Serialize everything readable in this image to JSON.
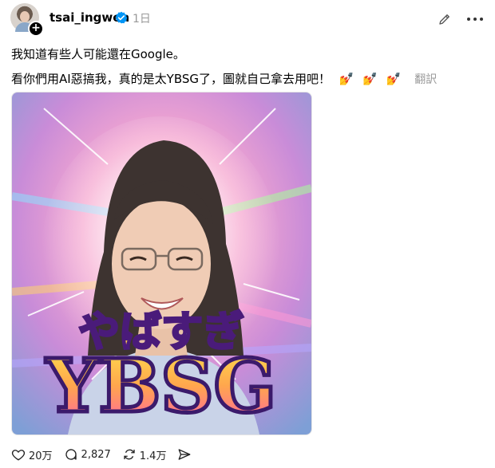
{
  "post": {
    "username": "tsai_ingwen",
    "time": "1日",
    "text_line1": "我知道有些人可能還在Google。",
    "text_line2": "看你們用AI惡搞我，真的是太YBSG了，圖就自己拿去用吧！",
    "emojis": [
      "💅",
      "💅",
      "💅"
    ],
    "translate_label": "翻訳"
  },
  "image": {
    "top_text": "やばすぎ",
    "bottom_text": "YBSG"
  },
  "actions": {
    "likes": "20万",
    "comments": "2,827",
    "reposts": "1.4万"
  },
  "colors": {
    "verified": "#0095f6",
    "muted": "#999999"
  }
}
